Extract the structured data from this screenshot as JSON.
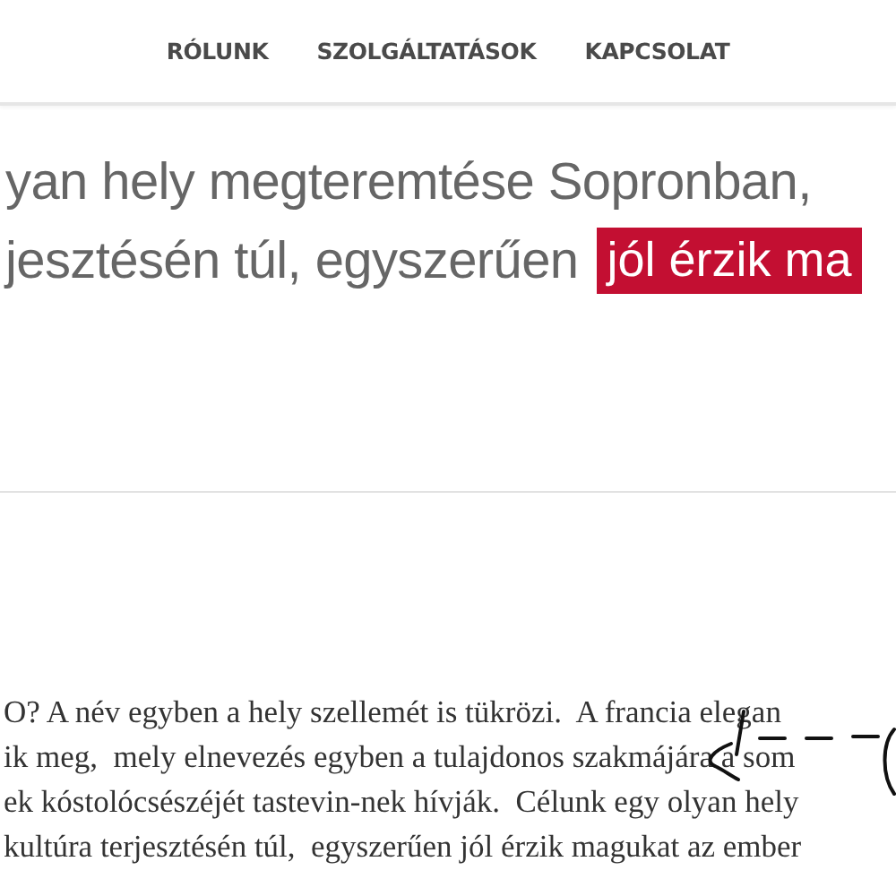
{
  "nav": {
    "items": [
      {
        "label": "RÓLUNK"
      },
      {
        "label": "SZOLGÁLTATÁSOK"
      },
      {
        "label": "KAPCSOLAT"
      }
    ]
  },
  "hero": {
    "lines": [
      "yan hely megteremtése Sopronban,",
      "jesztésén túl, egyszerűen"
    ],
    "highlight": "jól érzik ma"
  },
  "body": {
    "lines": [
      "O? A név egyben a hely szellemét is tükrözi.  A francia elegan",
      "ik meg,  mely elnevezés egyben a tulajdonos szakmájára a som",
      "ek kóstolócsészéjét tastevin-nek hívják.  Célunk egy olyan hely",
      "kultúra terjesztésén túl,  egyszerűen jól érzik magukat az ember"
    ]
  }
}
